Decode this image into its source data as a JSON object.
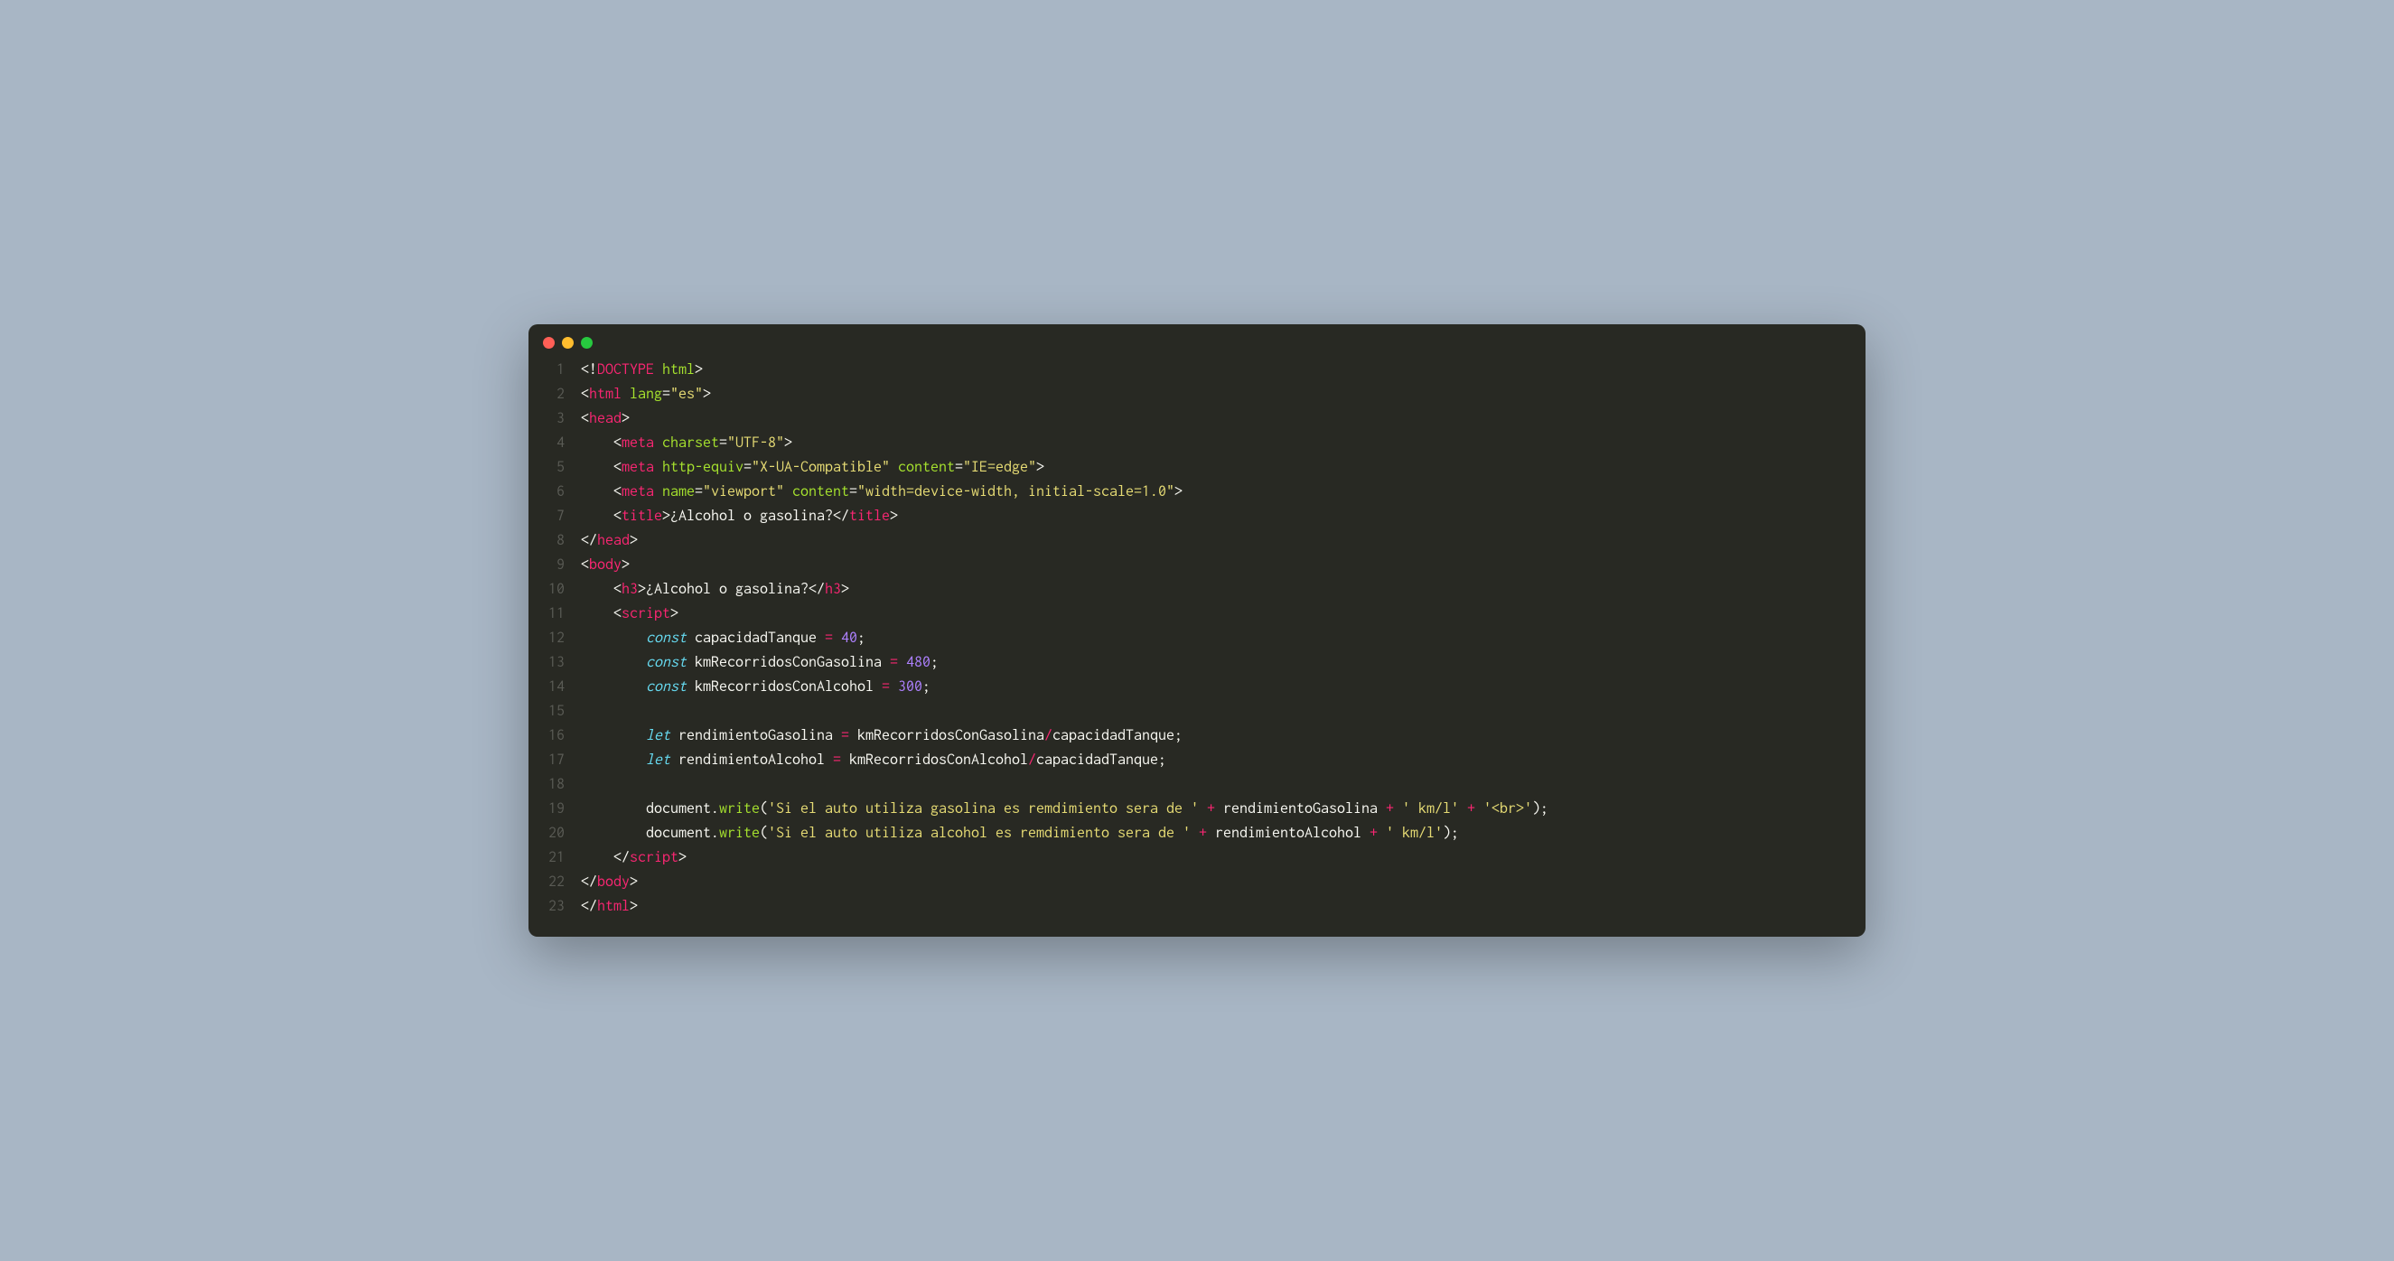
{
  "window": {
    "dots": [
      "red",
      "yellow",
      "green"
    ]
  },
  "lines": {
    "count": 23,
    "numbers": [
      "1",
      "2",
      "3",
      "4",
      "5",
      "6",
      "7",
      "8",
      "9",
      "10",
      "11",
      "12",
      "13",
      "14",
      "15",
      "16",
      "17",
      "18",
      "19",
      "20",
      "21",
      "22",
      "23"
    ]
  },
  "code": {
    "l1": {
      "a": "<!",
      "b": "DOCTYPE",
      "c": " html",
      "d": ">"
    },
    "l2": {
      "a": "<",
      "b": "html",
      "c": " lang",
      "d": "=",
      "e": "\"es\"",
      "f": ">"
    },
    "l3": {
      "a": "<",
      "b": "head",
      "c": ">"
    },
    "l4": {
      "a": "    <",
      "b": "meta",
      "c": " charset",
      "d": "=",
      "e": "\"UTF-8\"",
      "f": ">"
    },
    "l5": {
      "a": "    <",
      "b": "meta",
      "c": " http-equiv",
      "d": "=",
      "e": "\"X-UA-Compatible\"",
      "f": " content",
      "g": "=",
      "h": "\"IE=edge\"",
      "i": ">"
    },
    "l6": {
      "a": "    <",
      "b": "meta",
      "c": " name",
      "d": "=",
      "e": "\"viewport\"",
      "f": " content",
      "g": "=",
      "h": "\"width=device-width, initial-scale=1.0\"",
      "i": ">"
    },
    "l7": {
      "a": "    <",
      "b": "title",
      "c": ">",
      "d": "¿Alcohol o gasolina?",
      "e": "</",
      "f": "title",
      "g": ">"
    },
    "l8": {
      "a": "</",
      "b": "head",
      "c": ">"
    },
    "l9": {
      "a": "<",
      "b": "body",
      "c": ">"
    },
    "l10": {
      "a": "    <",
      "b": "h3",
      "c": ">",
      "d": "¿Alcohol o gasolina?",
      "e": "</",
      "f": "h3",
      "g": ">"
    },
    "l11": {
      "a": "    <",
      "b": "script",
      "c": ">"
    },
    "l12": {
      "a": "        ",
      "b": "const",
      "c": " capacidadTanque ",
      "d": "=",
      "e": " ",
      "f": "40",
      "g": ";"
    },
    "l13": {
      "a": "        ",
      "b": "const",
      "c": " kmRecorridosConGasolina ",
      "d": "=",
      "e": " ",
      "f": "480",
      "g": ";"
    },
    "l14": {
      "a": "        ",
      "b": "const",
      "c": " kmRecorridosConAlcohol ",
      "d": "=",
      "e": " ",
      "f": "300",
      "g": ";"
    },
    "l15": {
      "a": ""
    },
    "l16": {
      "a": "        ",
      "b": "let",
      "c": " rendimientoGasolina ",
      "d": "=",
      "e": " kmRecorridosConGasolina",
      "f": "/",
      "g": "capacidadTanque;"
    },
    "l17": {
      "a": "        ",
      "b": "let",
      "c": " rendimientoAlcohol ",
      "d": "=",
      "e": " kmRecorridosConAlcohol",
      "f": "/",
      "g": "capacidadTanque;"
    },
    "l18": {
      "a": ""
    },
    "l19": {
      "a": "        document.",
      "b": "write",
      "c": "(",
      "d": "'Si el auto utiliza gasolina es remdimiento sera de '",
      "e": " ",
      "f": "+",
      "g": " rendimientoGasolina ",
      "h": "+",
      "i": " ",
      "j": "' km/l'",
      "k": " ",
      "l": "+",
      "m": " ",
      "n": "'<br>'",
      "o": ");"
    },
    "l20": {
      "a": "        document.",
      "b": "write",
      "c": "(",
      "d": "'Si el auto utiliza alcohol es remdimiento sera de '",
      "e": " ",
      "f": "+",
      "g": " rendimientoAlcohol ",
      "h": "+",
      "i": " ",
      "j": "' km/l'",
      "k": ");"
    },
    "l21": {
      "a": "    </",
      "b": "script",
      "c": ">"
    },
    "l22": {
      "a": "</",
      "b": "body",
      "c": ">"
    },
    "l23": {
      "a": "</",
      "b": "html",
      "c": ">"
    }
  }
}
